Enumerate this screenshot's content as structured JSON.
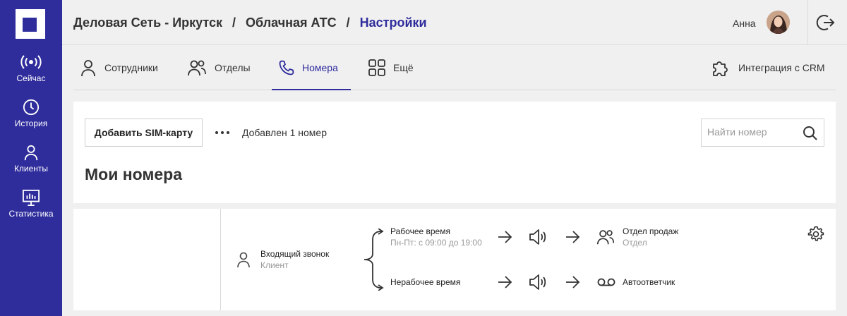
{
  "sidebar": {
    "items": [
      {
        "label": "Сейчас",
        "icon": "broadcast-icon"
      },
      {
        "label": "История",
        "icon": "clock-icon"
      },
      {
        "label": "Клиенты",
        "icon": "person-icon"
      },
      {
        "label": "Статистика",
        "icon": "chart-icon"
      }
    ]
  },
  "header": {
    "crumbs": [
      "Деловая Сеть - Иркутск",
      "Облачная АТС",
      "Настройки"
    ],
    "separator": "/",
    "user_name": "Анна"
  },
  "tabs": {
    "items": [
      {
        "label": "Сотрудники"
      },
      {
        "label": "Отделы"
      },
      {
        "label": "Номера"
      },
      {
        "label": "Ещё"
      }
    ],
    "crm_label": "Интеграция с CRM"
  },
  "toolbar": {
    "add_sim_label": "Добавить SIM-карту",
    "added_text": "Добавлен 1 номер",
    "search_placeholder": "Найти номер"
  },
  "page_title": "Мои номера",
  "flow": {
    "incoming": {
      "title": "Входящий звонок",
      "sub": "Клиент"
    },
    "work": {
      "title": "Рабочее время",
      "sub": "Пн-Пт: с 09:00 до 19:00"
    },
    "nonwork": {
      "title": "Нерабочее время"
    },
    "dept": {
      "title": "Отдел продаж",
      "sub": "Отдел"
    },
    "answering": {
      "title": "Автоответчик"
    }
  },
  "colors": {
    "accent": "#2f2d9c",
    "background": "#f0f0f1"
  }
}
